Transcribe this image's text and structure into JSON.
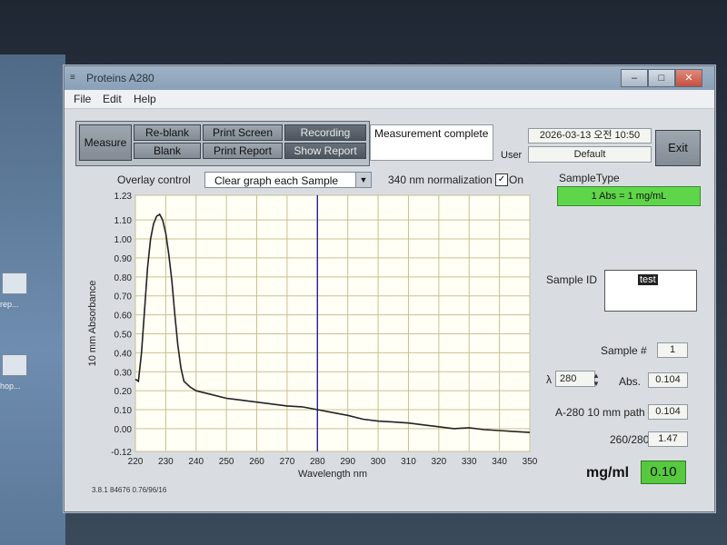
{
  "desktop": {
    "icon_labels": [
      "rep...",
      "hop..."
    ]
  },
  "window": {
    "title": "Proteins A280"
  },
  "menu": [
    "File",
    "Edit",
    "Help"
  ],
  "toolbar": {
    "measure": "Measure",
    "reblank": "Re-blank",
    "blank": "Blank",
    "print_screen": "Print Screen",
    "print_report": "Print Report",
    "recording": "Recording",
    "show_report": "Show Report"
  },
  "status": {
    "message": "Measurement complete",
    "datetime": "2026-03-13 오전 10:50",
    "user_label": "User",
    "user_value": "Default",
    "exit": "Exit"
  },
  "overlay": {
    "label": "Overlay control",
    "selected": "Clear graph each Sample",
    "normalization_label": "340 nm normalization",
    "normalization_on": true,
    "on_label": "On"
  },
  "sample": {
    "type_label": "SampleType",
    "type_value": "1 Abs = 1 mg/mL",
    "id_label": "Sample ID",
    "id_value": "test",
    "number_label": "Sample #",
    "number_value": "1",
    "lambda_label": "λ",
    "lambda_value": "280",
    "abs_label": "Abs.",
    "abs_value": "0.104",
    "a280_label": "A-280 10 mm path",
    "a280_value": "0.104",
    "ratio_label": "260/280",
    "ratio_value": "1.47",
    "conc_label": "mg/ml",
    "conc_value": "0.10"
  },
  "footer": "3.8.1 84676 0.76/96/16",
  "chart_data": {
    "type": "line",
    "xlabel": "Wavelength nm",
    "ylabel": "10 mm Absorbance",
    "xlim": [
      220,
      350
    ],
    "ylim": [
      -0.12,
      1.23
    ],
    "x_ticks": [
      220,
      230,
      240,
      250,
      260,
      270,
      280,
      290,
      300,
      310,
      320,
      330,
      340,
      350
    ],
    "y_ticks": [
      -0.12,
      0.0,
      0.1,
      0.2,
      0.3,
      0.4,
      0.5,
      0.6,
      0.7,
      0.8,
      0.9,
      1.0,
      1.1,
      1.23
    ],
    "y_tick_labels": [
      "-0.12",
      "0.00",
      "0.10",
      "0.20",
      "0.30",
      "0.40",
      "0.50",
      "0.60",
      "0.70",
      "0.80",
      "0.90",
      "1.00",
      "1.10",
      "1.23"
    ],
    "marker_x": 280,
    "grid": true,
    "colors": {
      "line": "#222222",
      "marker": "#2020a0",
      "grid": "#c8c090",
      "bg": "#fffff6"
    },
    "series": [
      {
        "x": [
          220,
          221,
          222,
          223,
          224,
          225,
          226,
          227,
          228,
          229,
          230,
          231,
          232,
          233,
          234,
          235,
          236,
          238,
          240,
          245,
          250,
          255,
          260,
          265,
          270,
          275,
          280,
          285,
          290,
          295,
          300,
          305,
          310,
          315,
          320,
          325,
          330,
          335,
          340,
          345,
          350
        ],
        "y": [
          0.26,
          0.25,
          0.4,
          0.62,
          0.85,
          1.0,
          1.08,
          1.12,
          1.13,
          1.1,
          1.03,
          0.92,
          0.78,
          0.6,
          0.44,
          0.32,
          0.25,
          0.22,
          0.2,
          0.18,
          0.16,
          0.15,
          0.14,
          0.13,
          0.12,
          0.115,
          0.1,
          0.085,
          0.07,
          0.05,
          0.04,
          0.035,
          0.03,
          0.02,
          0.01,
          0.0,
          0.005,
          -0.005,
          -0.01,
          -0.015,
          -0.02
        ]
      }
    ]
  }
}
